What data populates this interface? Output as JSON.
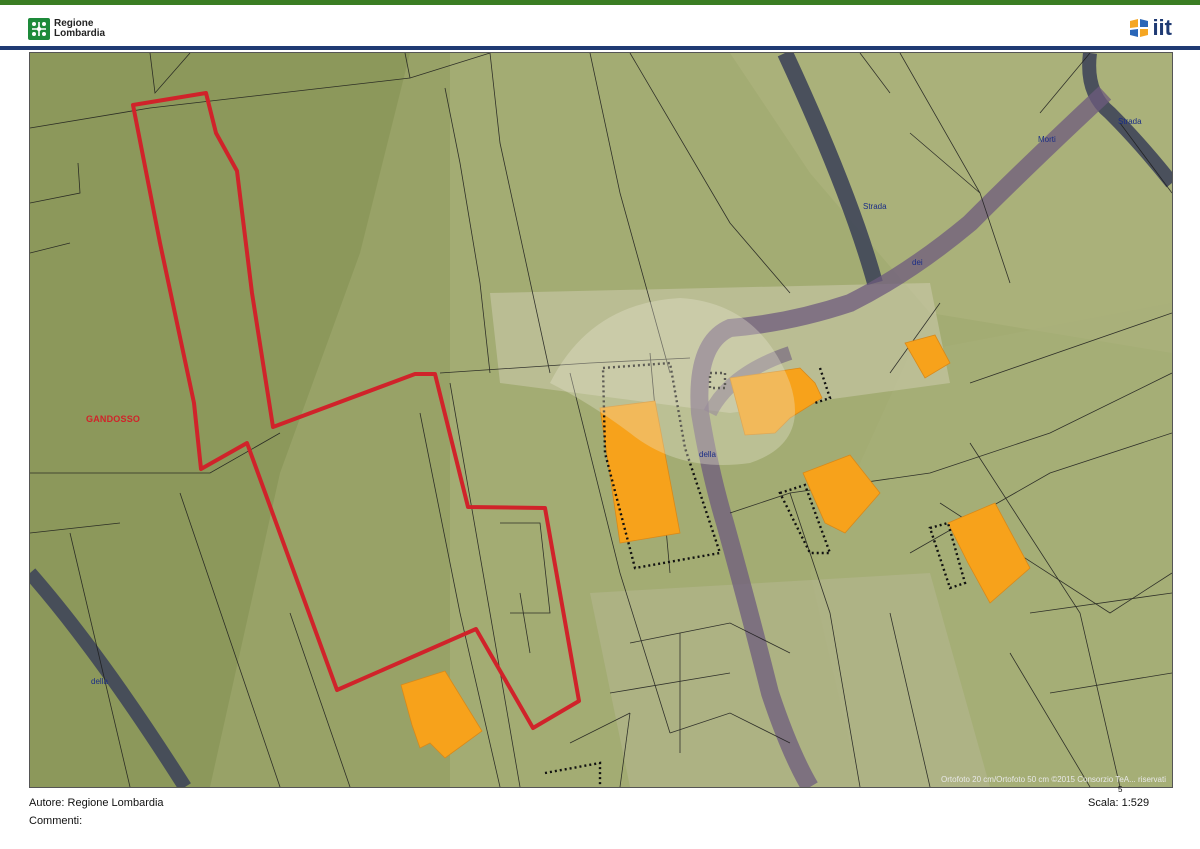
{
  "header": {
    "left_logo_text_line1": "Regione",
    "left_logo_text_line2": "Lombardia",
    "right_logo_text": "iit",
    "top_bar_color": "#3b7d23",
    "rule_color": "#1f3a73"
  },
  "map": {
    "municipality_label": "GANDOSSO",
    "place_labels": [
      "della",
      "Strada",
      "Morti",
      "Strada",
      "dei",
      "della"
    ],
    "credit": "Ortofoto 20 cm/Ortofoto 50 cm ©2015 Consorzio TeA... riservati",
    "parcel_outline_color": "#d0232a",
    "building_color": "#f7a21b"
  },
  "footer": {
    "author": "Autore: Regione Lombardia",
    "comments": "Commenti:",
    "scale": "Scala: 1:529",
    "scale_tick": "5"
  }
}
